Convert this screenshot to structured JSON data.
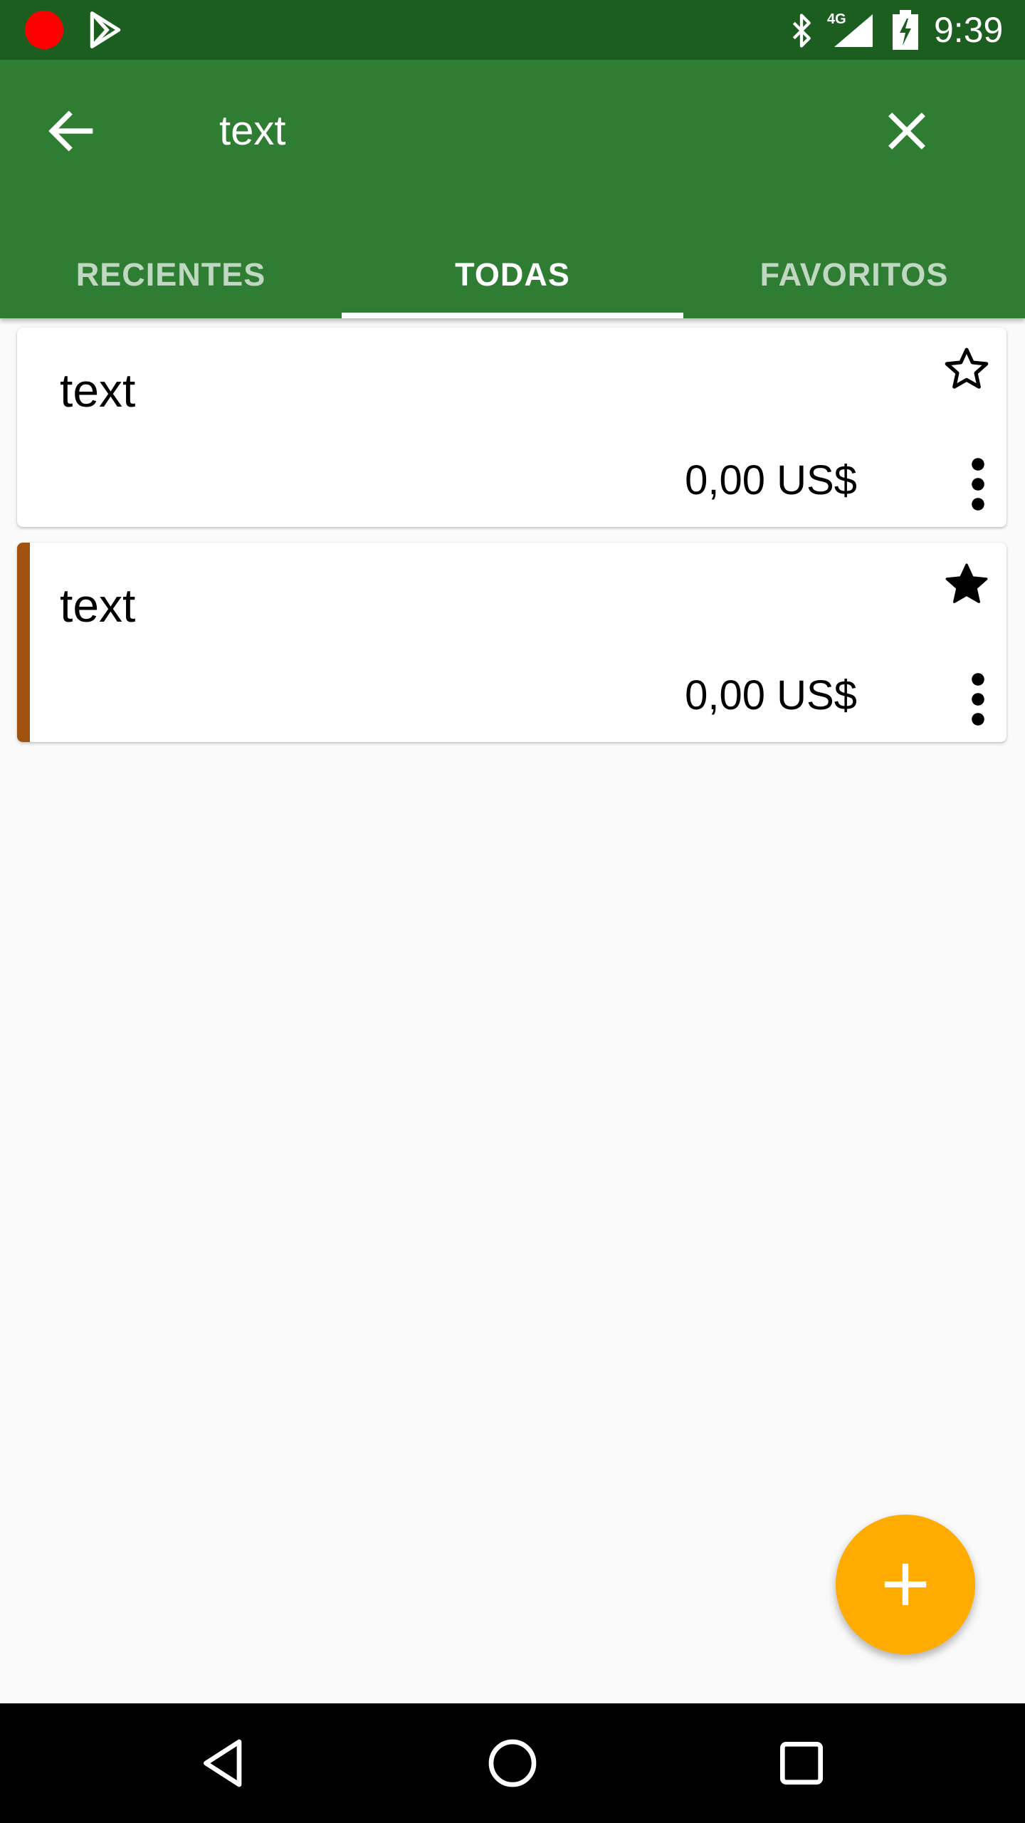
{
  "status_bar": {
    "time": "9:39",
    "network": "4G",
    "icons": [
      "record-icon",
      "play-store-icon",
      "bluetooth-icon",
      "signal-icon",
      "battery-charging-icon"
    ]
  },
  "search": {
    "query": "text",
    "icons": [
      "arrow-back-icon",
      "close-icon"
    ]
  },
  "tabs": [
    {
      "label": "RECIENTES",
      "active": false
    },
    {
      "label": "TODAS",
      "active": true
    },
    {
      "label": "FAVORITOS",
      "active": false
    }
  ],
  "cards": [
    {
      "title": "text",
      "price": "0,00 US$",
      "favorite": false,
      "accent_color": null
    },
    {
      "title": "text",
      "price": "0,00 US$",
      "favorite": true,
      "accent_color": "#a0520e"
    }
  ],
  "fab": {
    "icon": "plus-icon",
    "color": "#ffab00"
  },
  "nav_bar": {
    "icons": [
      "nav-back-icon",
      "nav-home-icon",
      "nav-recents-icon"
    ]
  },
  "colors": {
    "status_bar": "#1b5e20",
    "app_bar": "#2e7d32",
    "background": "#fafafa"
  }
}
